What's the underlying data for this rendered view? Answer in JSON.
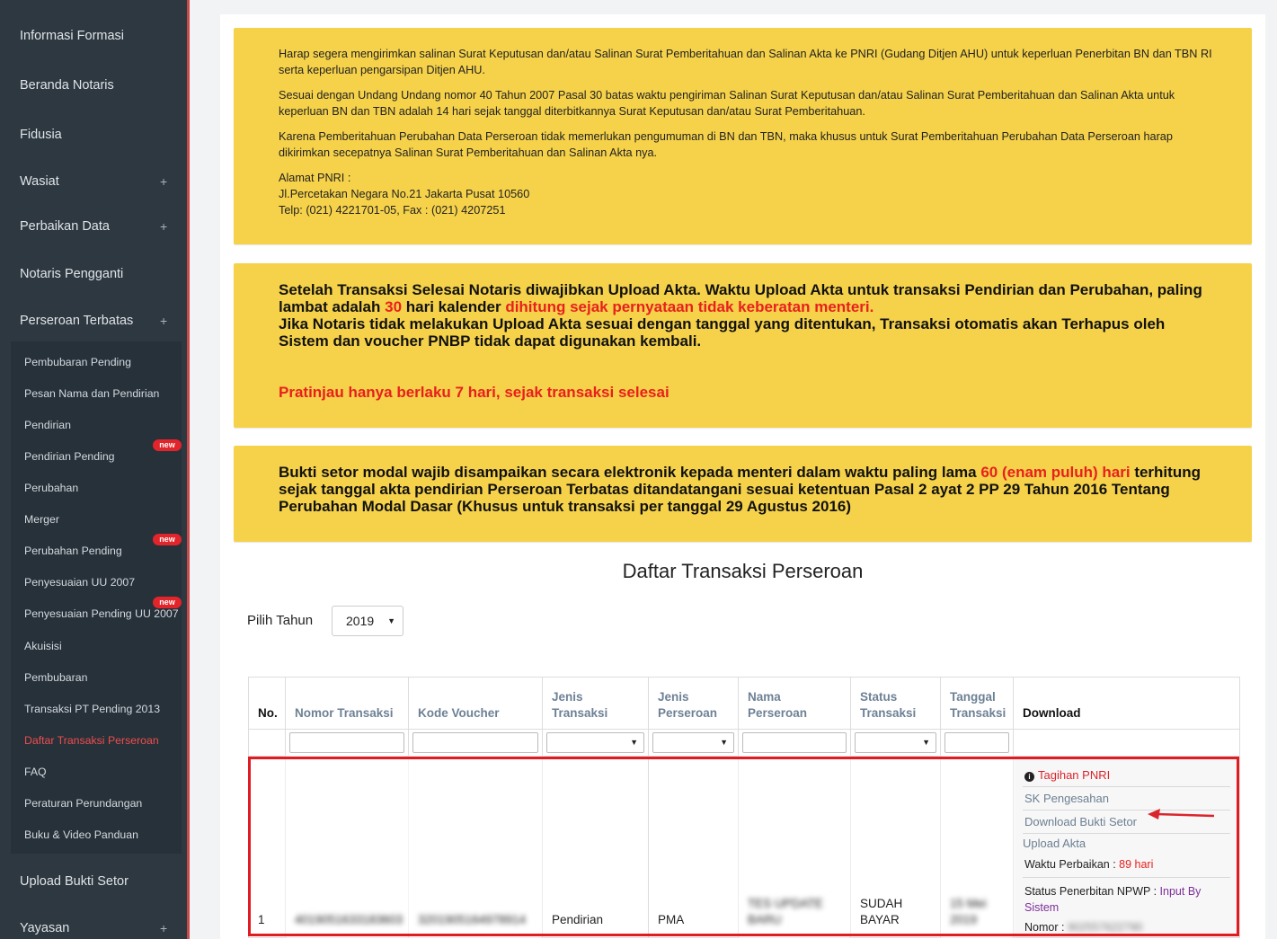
{
  "sidebar": {
    "top_items": [
      {
        "label": "Informasi Formasi",
        "plus": ""
      },
      {
        "label": "Beranda Notaris",
        "plus": ""
      },
      {
        "label": "Fidusia",
        "plus": ""
      },
      {
        "label": "Wasiat",
        "plus": "+"
      },
      {
        "label": "Perbaikan Data",
        "plus": "+"
      },
      {
        "label": "Notaris Pengganti",
        "plus": ""
      },
      {
        "label": "Perseroan Terbatas",
        "plus": "+"
      }
    ],
    "sub_items": [
      "Pembubaran Pending",
      "Pesan Nama dan Pendirian",
      "Pendirian",
      "Pendirian Pending",
      "Perubahan",
      "Merger",
      "Perubahan Pending",
      "Penyesuaian UU 2007",
      "Penyesuaian Pending UU 2007",
      "Akuisisi",
      "Pembubaran",
      "Transaksi PT Pending 2013",
      "Daftar Transaksi Perseroan",
      "FAQ",
      "Peraturan Perundangan",
      "Buku & Video Panduan"
    ],
    "badge_text": "new",
    "bottom_items": [
      {
        "label": "Upload Bukti Setor",
        "plus": ""
      },
      {
        "label": "Yayasan",
        "plus": "+"
      }
    ]
  },
  "notice1": {
    "p1": "Harap segera mengirimkan salinan Surat Keputusan dan/atau Salinan Surat Pemberitahuan dan Salinan Akta ke PNRI (Gudang Ditjen AHU) untuk keperluan Penerbitan BN dan TBN RI serta keperluan pengarsipan Ditjen AHU.",
    "p2": "Sesuai dengan Undang Undang nomor 40 Tahun 2007 Pasal 30 batas waktu pengiriman Salinan Surat Keputusan dan/atau Salinan Surat Pemberitahuan dan Salinan Akta untuk keperluan BN dan TBN adalah 14 hari sejak tanggal diterbitkannya Surat Keputusan dan/atau Surat Pemberitahuan.",
    "p3": "Karena Pemberitahuan Perubahan Data Perseroan tidak memerlukan pengumuman di BN dan TBN, maka khusus untuk Surat Pemberitahuan Perubahan Data Perseroan harap dikirimkan secepatnya Salinan Surat Pemberitahuan dan Salinan Akta nya.",
    "addr1": "Alamat PNRI :",
    "addr2": "Jl.Percetakan Negara No.21 Jakarta Pusat 10560",
    "addr3": "Telp: (021) 4221701-05, Fax : (021) 4207251"
  },
  "notice2": {
    "t1": "Setelah Transaksi Selesai Notaris diwajibkan Upload Akta. Waktu Upload Akta untuk transaksi Pendirian dan Perubahan, paling lambat adalah ",
    "t2": "30",
    "t3": " hari kalender ",
    "t4": "dihitung sejak pernyataan tidak keberatan menteri.",
    "t5": "Jika Notaris tidak melakukan Upload Akta sesuai dengan tanggal yang ditentukan, Transaksi otomatis akan Terhapus oleh Sistem dan voucher PNBP tidak dapat digunakan kembali.",
    "t6": "Pratinjau hanya berlaku 7 hari, sejak transaksi selesai"
  },
  "notice3": {
    "t1": "Bukti setor modal wajib disampaikan secara elektronik kepada menteri dalam waktu paling lama ",
    "t2": "60 (enam puluh) hari",
    "t3": " terhitung sejak tanggal akta pendirian Perseroan Terbatas ditandatangani sesuai ketentuan Pasal 2 ayat 2 PP 29 Tahun 2016 Tentang Perubahan Modal Dasar (Khusus untuk transaksi per tanggal 29 Agustus 2016)"
  },
  "list": {
    "title": "Daftar Transaksi Perseroan",
    "year_label": "Pilih Tahun",
    "year_value": "2019"
  },
  "table": {
    "headers": [
      "No.",
      "Nomor Transaksi",
      "Kode Voucher",
      "Jenis Transaksi",
      "Jenis Perseroan",
      "Nama Perseroan",
      "Status Transaksi",
      "Tanggal Transaksi",
      "Download"
    ],
    "row": {
      "no": "1",
      "nomor": "4019051633183603",
      "voucher": "3201905164978914",
      "jenis_transaksi": "Pendirian",
      "jenis_perseroan": "PMA",
      "nama": "TES UPDATE BARU",
      "status": "SUDAH BAYAR",
      "tanggal": "15 Mei 2019"
    },
    "download": {
      "tagihan": "Tagihan PNRI",
      "sk": "SK Pengesahan",
      "bukti": "Download Bukti Setor",
      "upload": "Upload Akta",
      "waktu_label": "Waktu Perbaikan : ",
      "waktu_value": "89 hari",
      "npwp_label": "Status Penerbitan NPWP : ",
      "npwp_value": "Input By Sistem",
      "nomor_label": "Nomor : ",
      "nomor_value": "902557622790"
    }
  }
}
